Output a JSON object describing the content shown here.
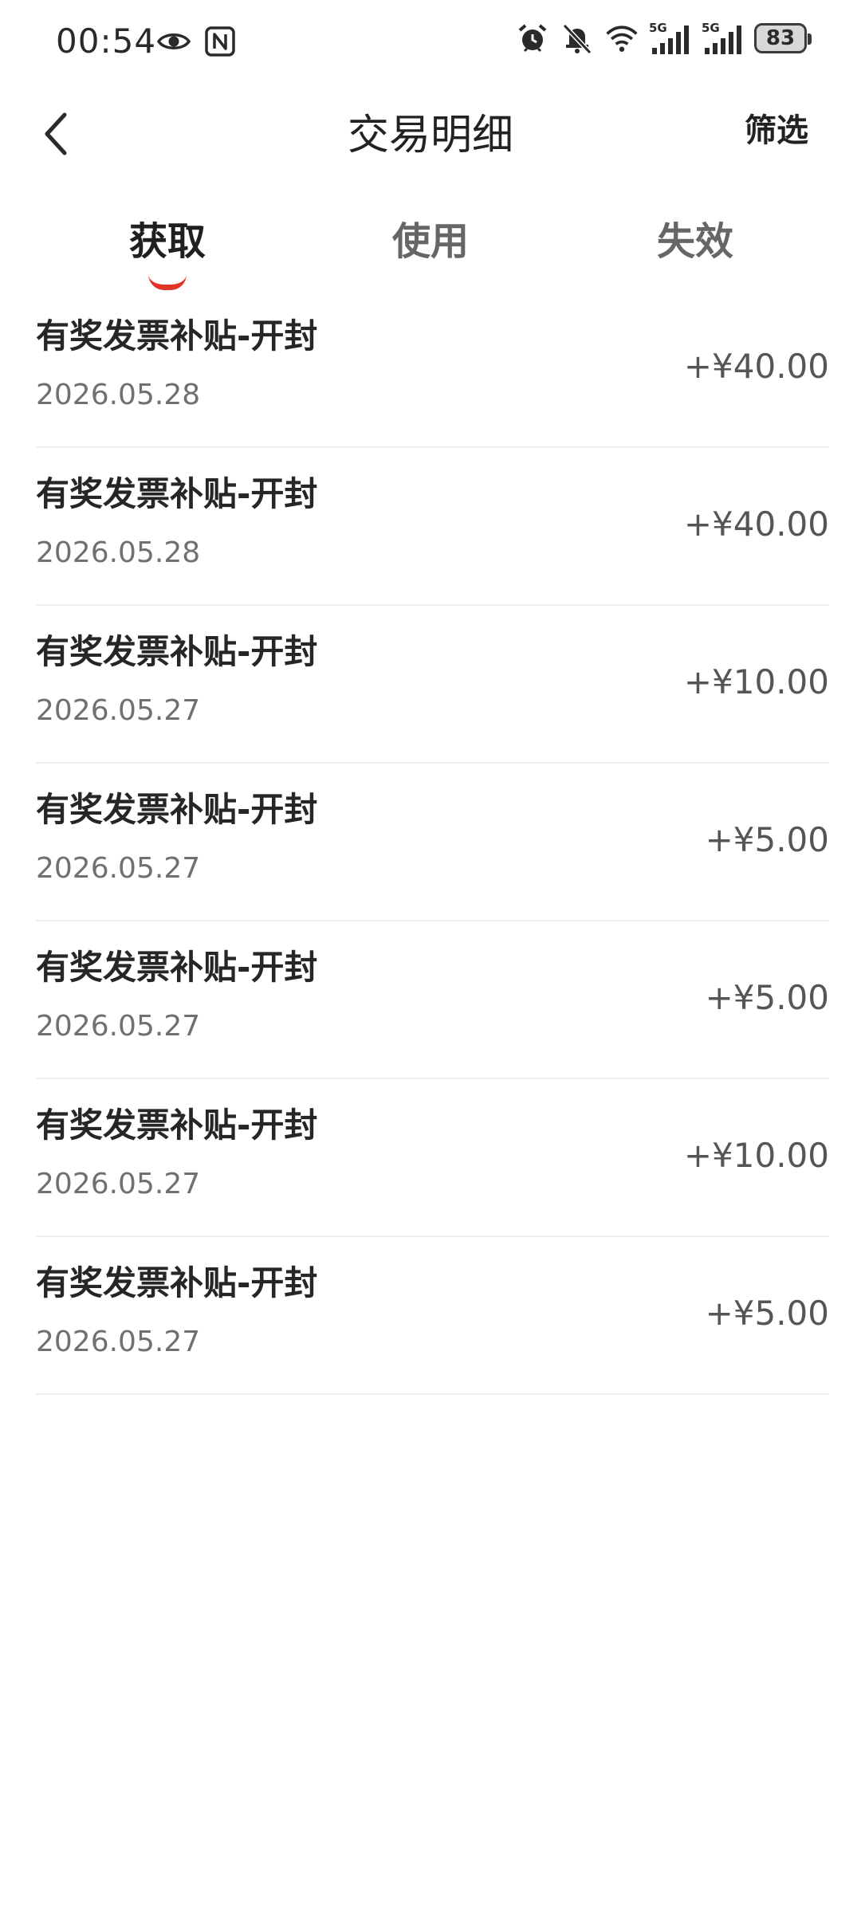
{
  "status_bar": {
    "time": "00:54",
    "battery": "83",
    "net_1": "5G",
    "net_2": "5G",
    "icons": [
      "eye-icon",
      "nfc-icon",
      "alarm-icon",
      "bell-muted-icon",
      "wifi-icon",
      "signal-icon",
      "signal-icon",
      "battery-icon"
    ]
  },
  "header": {
    "title": "交易明细",
    "filter_label": "筛选",
    "back_icon": "chevron-left-icon"
  },
  "tabs": [
    {
      "label": "获取",
      "active": true
    },
    {
      "label": "使用",
      "active": false
    },
    {
      "label": "失效",
      "active": false
    }
  ],
  "colors": {
    "accent": "#e2332a",
    "text_primary": "#262626",
    "text_secondary": "#707070",
    "divider": "#ececec"
  },
  "transactions": [
    {
      "title": "有奖发票补贴-开封",
      "date": "2026.05.28",
      "amount": "+¥40.00"
    },
    {
      "title": "有奖发票补贴-开封",
      "date": "2026.05.28",
      "amount": "+¥40.00"
    },
    {
      "title": "有奖发票补贴-开封",
      "date": "2026.05.27",
      "amount": "+¥10.00"
    },
    {
      "title": "有奖发票补贴-开封",
      "date": "2026.05.27",
      "amount": "+¥5.00"
    },
    {
      "title": "有奖发票补贴-开封",
      "date": "2026.05.27",
      "amount": "+¥5.00"
    },
    {
      "title": "有奖发票补贴-开封",
      "date": "2026.05.27",
      "amount": "+¥10.00"
    },
    {
      "title": "有奖发票补贴-开封",
      "date": "2026.05.27",
      "amount": "+¥5.00"
    }
  ]
}
